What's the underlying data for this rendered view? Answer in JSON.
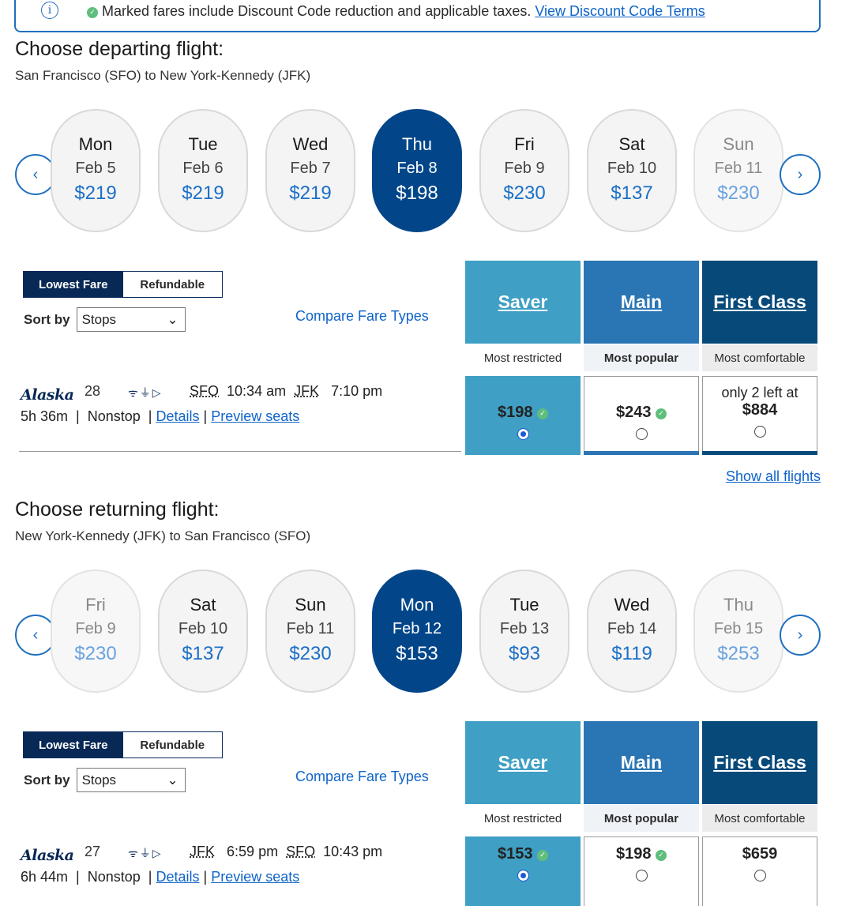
{
  "notice": {
    "text": "Marked fares include Discount Code reduction and applicable taxes.",
    "link": "View Discount Code Terms"
  },
  "depart": {
    "title": "Choose departing flight:",
    "subtitle": "San Francisco (SFO) to New York-Kennedy (JFK)",
    "days": [
      {
        "name": "Mon",
        "date": "Feb 5",
        "price": "$219"
      },
      {
        "name": "Tue",
        "date": "Feb 6",
        "price": "$219"
      },
      {
        "name": "Wed",
        "date": "Feb 7",
        "price": "$219"
      },
      {
        "name": "Thu",
        "date": "Feb 8",
        "price": "$198"
      },
      {
        "name": "Fri",
        "date": "Feb 9",
        "price": "$230"
      },
      {
        "name": "Sat",
        "date": "Feb 10",
        "price": "$137"
      },
      {
        "name": "Sun",
        "date": "Feb 11",
        "price": "$230"
      }
    ],
    "toggle": {
      "lowest": "Lowest Fare",
      "refundable": "Refundable"
    },
    "sort": {
      "label": "Sort by",
      "value": "Stops"
    },
    "compare": "Compare Fare Types",
    "fares": [
      {
        "name": "Saver",
        "desc": "Most restricted",
        "color": "#3f9fc4"
      },
      {
        "name": "Main",
        "desc": "Most popular",
        "color": "#2a75b3"
      },
      {
        "name": "First Class",
        "desc": "Most comfortable",
        "color": "#074a7a"
      }
    ],
    "flight": {
      "airline": "Alaska",
      "number": "28",
      "from": "SFO",
      "dep": "10:34 am",
      "to": "JFK",
      "arr": "7:10 pm",
      "duration": "5h 36m",
      "stops": "Nonstop",
      "details": "Details",
      "preview": "Preview seats",
      "prices": {
        "saver": "$198",
        "main": "$243",
        "first_note": "only 2 left at",
        "first": "$884"
      }
    },
    "show_all": "Show all flights"
  },
  "return": {
    "title": "Choose returning flight:",
    "subtitle": "New York-Kennedy (JFK) to San Francisco (SFO)",
    "days": [
      {
        "name": "Fri",
        "date": "Feb 9",
        "price": "$230"
      },
      {
        "name": "Sat",
        "date": "Feb 10",
        "price": "$137"
      },
      {
        "name": "Sun",
        "date": "Feb 11",
        "price": "$230"
      },
      {
        "name": "Mon",
        "date": "Feb 12",
        "price": "$153"
      },
      {
        "name": "Tue",
        "date": "Feb 13",
        "price": "$93"
      },
      {
        "name": "Wed",
        "date": "Feb 14",
        "price": "$119"
      },
      {
        "name": "Thu",
        "date": "Feb 15",
        "price": "$253"
      }
    ],
    "toggle": {
      "lowest": "Lowest Fare",
      "refundable": "Refundable"
    },
    "sort": {
      "label": "Sort by",
      "value": "Stops"
    },
    "compare": "Compare Fare Types",
    "fares": [
      {
        "name": "Saver",
        "desc": "Most restricted",
        "color": "#3f9fc4"
      },
      {
        "name": "Main",
        "desc": "Most popular",
        "color": "#2a75b3"
      },
      {
        "name": "First Class",
        "desc": "Most comfortable",
        "color": "#074a7a"
      }
    ],
    "flight": {
      "airline": "Alaska",
      "number": "27",
      "from": "JFK",
      "dep": "6:59 pm",
      "to": "SFO",
      "arr": "10:43 pm",
      "duration": "6h 44m",
      "stops": "Nonstop",
      "details": "Details",
      "preview": "Preview seats",
      "prices": {
        "saver": "$153",
        "main": "$198",
        "first": "$659"
      }
    }
  }
}
